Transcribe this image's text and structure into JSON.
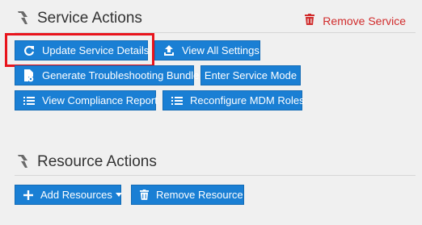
{
  "service_actions": {
    "title": "Service Actions",
    "remove_service_label": "Remove Service",
    "buttons": {
      "update_details": "Update Service Details",
      "view_settings": "View All Settings",
      "troubleshooting_bundle": "Generate Troubleshooting Bundle",
      "service_mode": "Enter Service Mode",
      "compliance_report": "View Compliance Report",
      "reconfigure_mdm": "Reconfigure MDM Roles"
    }
  },
  "resource_actions": {
    "title": "Resource Actions",
    "buttons": {
      "add_resources": "Add Resources",
      "remove_resource": "Remove Resource"
    }
  },
  "colors": {
    "button_blue": "#1a7fd4",
    "danger_red": "#d12c2c",
    "highlight_red": "#e8141c",
    "background": "#f0f0f0"
  },
  "icons": {
    "section_logo": "bolt-logo-icon",
    "remove_service": "trash-icon",
    "update_details": "refresh-icon",
    "view_settings": "upload-icon",
    "troubleshooting_bundle": "file-gear-icon",
    "compliance_report": "list-icon",
    "reconfigure_mdm": "list-icon",
    "add_resources": "plus-icon",
    "remove_resource": "trash-icon"
  }
}
